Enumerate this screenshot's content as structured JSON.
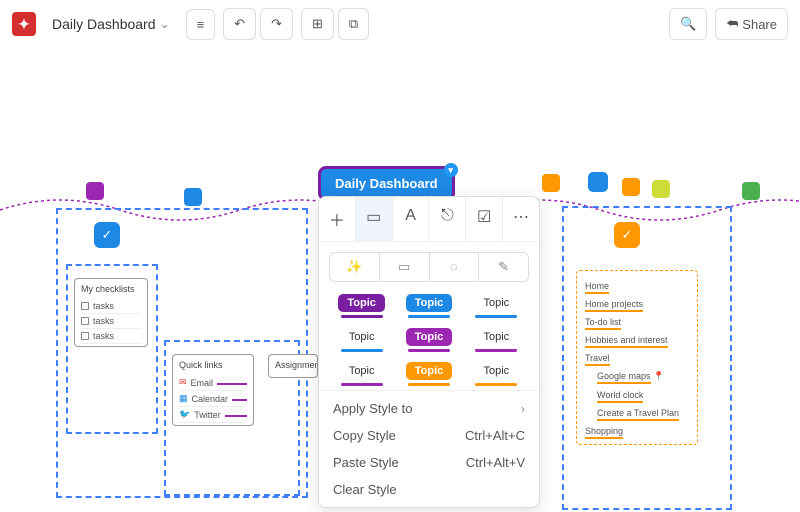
{
  "header": {
    "title": "Daily Dashboard",
    "share": "Share"
  },
  "central": "Daily Dashboard",
  "checklists": {
    "title": "My checklists",
    "items": [
      "tasks",
      "tasks",
      "tasks"
    ]
  },
  "quicklinks": {
    "title": "Quick links",
    "items": [
      "Email",
      "Calendar",
      "Twitter"
    ]
  },
  "assignments": {
    "title": "Assignments"
  },
  "home": {
    "title": "Home",
    "items": [
      "Home projects",
      "To-do list",
      "Hobbies and interest",
      "Travel"
    ],
    "sub": [
      "Google maps",
      "World clock",
      "Create a Travel Plan"
    ],
    "last": "Shopping"
  },
  "styles": {
    "grid": [
      {
        "bg": "#7b1fa2",
        "fg": "#fff",
        "line": "#7b1fa2",
        "text": "Topic"
      },
      {
        "bg": "#1e88e5",
        "fg": "#fff",
        "line": "#1e88e5",
        "text": "Topic"
      },
      {
        "bg": "transparent",
        "fg": "#333",
        "line": "#1e88e5",
        "text": "Topic"
      },
      {
        "bg": "transparent",
        "fg": "#333",
        "line": "#1e88e5",
        "text": "Topic"
      },
      {
        "bg": "#9c27b0",
        "fg": "#fff",
        "line": "#9c27b0",
        "text": "Topic"
      },
      {
        "bg": "transparent",
        "fg": "#333",
        "line": "#9c27b0",
        "text": "Topic"
      },
      {
        "bg": "transparent",
        "fg": "#333",
        "line": "#9c27b0",
        "text": "Topic"
      },
      {
        "bg": "#ff9800",
        "fg": "#fff",
        "line": "#ff9800",
        "text": "Topic"
      },
      {
        "bg": "transparent",
        "fg": "#333",
        "line": "#ff9800",
        "text": "Topic"
      }
    ]
  },
  "menu": {
    "apply": "Apply Style to",
    "copy": "Copy Style",
    "copy_sc": "Ctrl+Alt+C",
    "paste": "Paste Style",
    "paste_sc": "Ctrl+Alt+V",
    "clear": "Clear Style"
  }
}
